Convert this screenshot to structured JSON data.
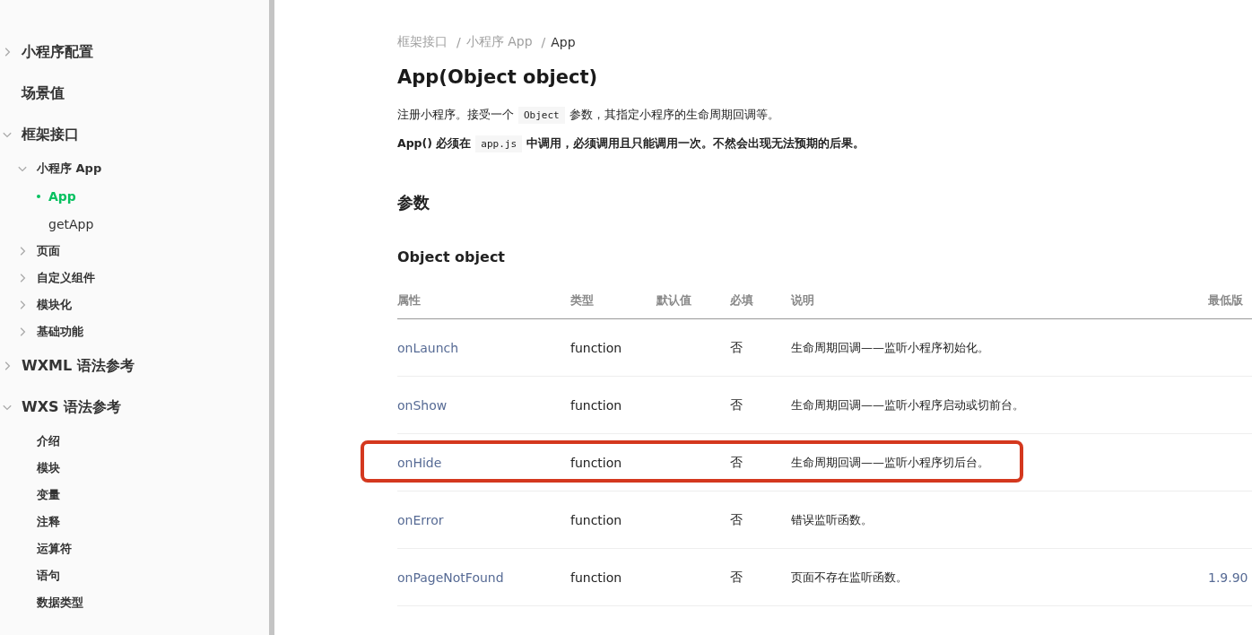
{
  "sidebar": {
    "items": [
      {
        "label": "小程序配置",
        "expanded": false,
        "selected": false
      },
      {
        "label": "场景值",
        "selected": false
      },
      {
        "label": "框架接口",
        "expanded": true,
        "selected": false,
        "children": [
          {
            "label": "小程序 App",
            "expanded": true,
            "selected": false,
            "children": [
              {
                "label": "App",
                "selected": true
              },
              {
                "label": "getApp",
                "selected": false
              }
            ]
          },
          {
            "label": "页面",
            "expanded": false,
            "selected": false
          },
          {
            "label": "自定义组件",
            "expanded": false,
            "selected": false
          },
          {
            "label": "模块化",
            "expanded": false,
            "selected": false
          },
          {
            "label": "基础功能",
            "expanded": false,
            "selected": false
          }
        ]
      },
      {
        "label": "WXML 语法参考",
        "expanded": false,
        "selected": false
      },
      {
        "label": "WXS 语法参考",
        "expanded": true,
        "selected": false,
        "children": [
          {
            "label": "介绍",
            "selected": false
          },
          {
            "label": "模块",
            "selected": false
          },
          {
            "label": "变量",
            "selected": false
          },
          {
            "label": "注释",
            "selected": false
          },
          {
            "label": "运算符",
            "selected": false
          },
          {
            "label": "语句",
            "selected": false
          },
          {
            "label": "数据类型",
            "selected": false
          }
        ]
      }
    ]
  },
  "breadcrumb": [
    {
      "label": "框架接口"
    },
    {
      "separator": "/",
      "label": "小程序 App"
    },
    {
      "separator": "/",
      "label": "App"
    }
  ],
  "title": "App(Object object)",
  "paragraphs": [
    {
      "bold": false,
      "parts": [
        {
          "kind": "text",
          "text": "注册小程序。接受一个"
        },
        {
          "kind": "code",
          "text": "Object"
        },
        {
          "kind": "text",
          "text": "参数，其指定小程序的生命周期回调等。"
        }
      ]
    },
    {
      "bold": true,
      "parts": [
        {
          "kind": "text",
          "text": "App() 必须在"
        },
        {
          "kind": "code",
          "text": "app.js"
        },
        {
          "kind": "text",
          "text": "中调用，必须调用且只能调用一次。不然会出现无法预期的后果。"
        }
      ]
    }
  ],
  "section_heading": "参数",
  "subsection_heading": "Object object",
  "table": {
    "columns": [
      "属性",
      "类型",
      "默认值",
      "必填",
      "说明",
      "最低版"
    ],
    "rows": [
      {
        "highlighted": false,
        "cells": [
          "onLaunch",
          "function",
          "",
          "否",
          "生命周期回调——监听小程序初始化。",
          ""
        ]
      },
      {
        "highlighted": false,
        "cells": [
          "onShow",
          "function",
          "",
          "否",
          "生命周期回调——监听小程序启动或切前台。",
          ""
        ]
      },
      {
        "highlighted": true,
        "cells": [
          "onHide",
          "function",
          "",
          "否",
          "生命周期回调——监听小程序切后台。",
          ""
        ]
      },
      {
        "highlighted": false,
        "cells": [
          "onError",
          "function",
          "",
          "否",
          "错误监听函数。",
          ""
        ]
      },
      {
        "highlighted": false,
        "cells": [
          "onPageNotFound",
          "function",
          "",
          "否",
          "页面不存在监听函数。",
          "1.9.90"
        ]
      }
    ]
  }
}
